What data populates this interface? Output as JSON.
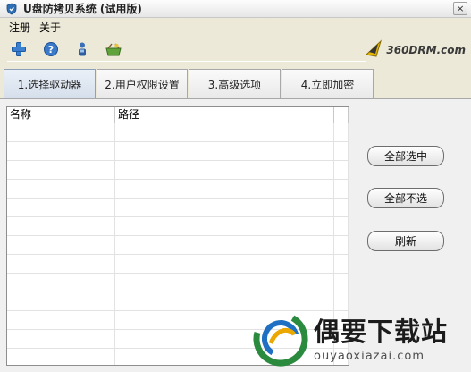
{
  "window": {
    "title": "U盘防拷贝系统 (试用版)",
    "close_label": "×"
  },
  "menu": [
    {
      "label": "注册"
    },
    {
      "label": "关于"
    }
  ],
  "toolbar": {
    "icons": [
      "add-icon",
      "help-icon",
      "user-icon",
      "basket-icon"
    ]
  },
  "brand": {
    "text": "360DRM.com"
  },
  "tabs": [
    {
      "label": "1.选择驱动器",
      "active": true
    },
    {
      "label": "2.用户权限设置",
      "active": false
    },
    {
      "label": "3.高级选项",
      "active": false
    },
    {
      "label": "4.立即加密",
      "active": false
    }
  ],
  "table": {
    "columns": [
      "名称",
      "路径",
      ""
    ],
    "rows": []
  },
  "actions": {
    "select_all": "全部选中",
    "deselect_all": "全部不选",
    "refresh": "刷新"
  },
  "watermark": {
    "title": "偶要下载站",
    "url": "ouyaoxiazai.com"
  }
}
